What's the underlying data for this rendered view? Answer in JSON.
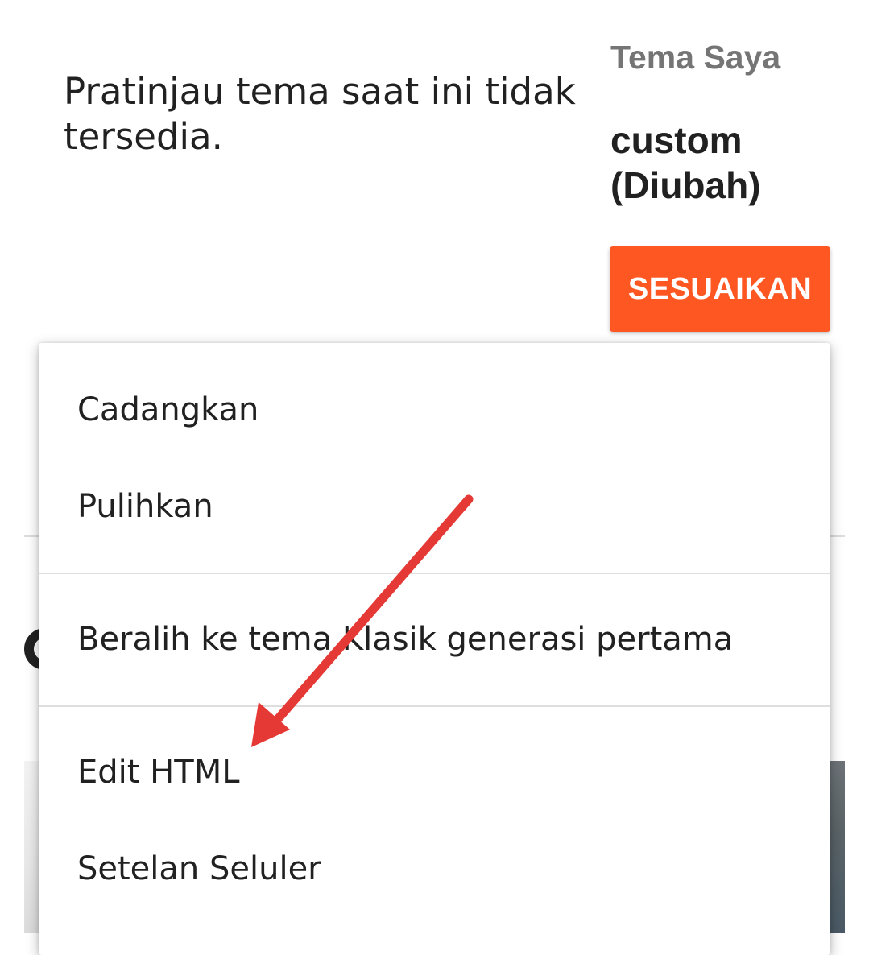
{
  "preview": {
    "message": "Pratinjau tema saat ini tidak tersedia."
  },
  "theme": {
    "section_label": "Tema Saya",
    "name": "custom (Diubah)",
    "customize_label": "SESUAIKAN",
    "accent_color": "#ff5722"
  },
  "menu": {
    "items": [
      {
        "label": "Cadangkan"
      },
      {
        "label": "Pulihkan"
      },
      {
        "label": "Beralih ke tema Klasik generasi pertama"
      },
      {
        "label": "Edit HTML"
      },
      {
        "label": "Setelan Seluler"
      }
    ]
  },
  "annotation": {
    "arrow_color": "#e53935",
    "arrow_target": "Edit HTML"
  }
}
